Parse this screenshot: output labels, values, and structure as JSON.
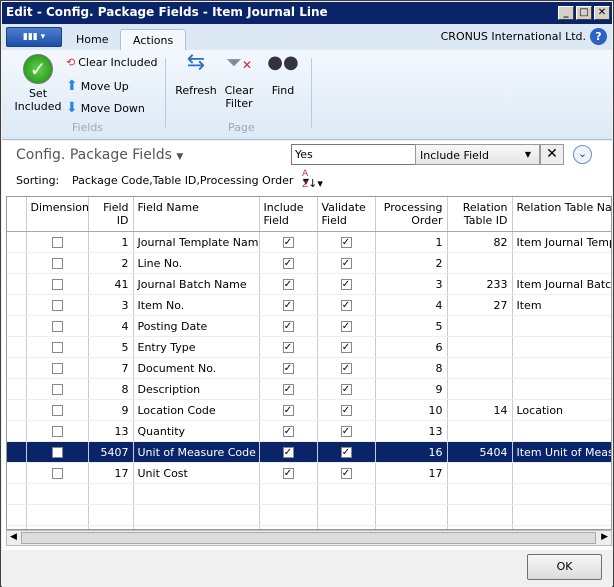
{
  "window": {
    "title": "Edit - Config. Package Fields - Item Journal Line"
  },
  "tabs": [
    {
      "label": "Home"
    },
    {
      "label": "Actions",
      "active": true
    }
  ],
  "company": "CRONUS International Ltd.",
  "ribbon": {
    "set_included": "Set Included",
    "clear_included": "Clear Included",
    "move_up": "Move Up",
    "move_down": "Move Down",
    "fields_group": "Fields",
    "refresh": "Refresh",
    "clear_filter": "Clear Filter",
    "find": "Find",
    "page_group": "Page"
  },
  "page": {
    "title": "Config. Package Fields",
    "filter_value": "Yes",
    "filter_field": "Include Field",
    "sorting_label": "Sorting:",
    "sorting_value": "Package Code,Table ID,Processing Order"
  },
  "columns": [
    "Dimension",
    "Field ID",
    "Field Name",
    "Include Field",
    "Validate Field",
    "Processing Order",
    "Relation Table ID",
    "Relation Table Name"
  ],
  "rows": [
    {
      "dim": false,
      "id": "1",
      "name": "Journal Template Name",
      "inc": true,
      "val": true,
      "order": "1",
      "rid": "82",
      "rname": "Item Journal Template"
    },
    {
      "dim": false,
      "id": "2",
      "name": "Line No.",
      "inc": true,
      "val": true,
      "order": "2",
      "rid": "",
      "rname": ""
    },
    {
      "dim": false,
      "id": "41",
      "name": "Journal Batch Name",
      "inc": true,
      "val": true,
      "order": "3",
      "rid": "233",
      "rname": "Item Journal Batch"
    },
    {
      "dim": false,
      "id": "3",
      "name": "Item No.",
      "inc": true,
      "val": true,
      "order": "4",
      "rid": "27",
      "rname": "Item"
    },
    {
      "dim": false,
      "id": "4",
      "name": "Posting Date",
      "inc": true,
      "val": true,
      "order": "5",
      "rid": "",
      "rname": ""
    },
    {
      "dim": false,
      "id": "5",
      "name": "Entry Type",
      "inc": true,
      "val": true,
      "order": "6",
      "rid": "",
      "rname": ""
    },
    {
      "dim": false,
      "id": "7",
      "name": "Document No.",
      "inc": true,
      "val": true,
      "order": "8",
      "rid": "",
      "rname": ""
    },
    {
      "dim": false,
      "id": "8",
      "name": "Description",
      "inc": true,
      "val": true,
      "order": "9",
      "rid": "",
      "rname": ""
    },
    {
      "dim": false,
      "id": "9",
      "name": "Location Code",
      "inc": true,
      "val": true,
      "order": "10",
      "rid": "14",
      "rname": "Location"
    },
    {
      "dim": false,
      "id": "13",
      "name": "Quantity",
      "inc": true,
      "val": true,
      "order": "13",
      "rid": "",
      "rname": ""
    },
    {
      "dim": false,
      "id": "5407",
      "name": "Unit of Measure Code",
      "inc": true,
      "val": true,
      "order": "16",
      "rid": "5404",
      "rname": "Item Unit of Measure",
      "selected": true
    },
    {
      "dim": false,
      "id": "17",
      "name": "Unit Cost",
      "inc": true,
      "val": true,
      "order": "17",
      "rid": "",
      "rname": ""
    }
  ],
  "ok_label": "OK"
}
